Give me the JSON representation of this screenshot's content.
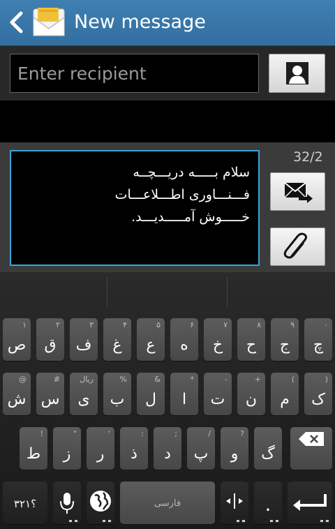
{
  "header": {
    "title": "New message",
    "back_icon": "chevron-left-icon",
    "app_icon": "envelope-icon"
  },
  "recipient": {
    "placeholder": "Enter recipient",
    "contact_icon": "contact-person-icon"
  },
  "compose": {
    "message": "سلام بـــــه دریـــچــه\nفـــنـــاوری اطـــلاعـــات\nخـــــوش آمـــــدیـــد.",
    "counter": "32/2",
    "send_icon": "send-message-icon",
    "attach_icon": "paperclip-icon"
  },
  "keyboard": {
    "row1": [
      {
        "main": "ص",
        "sub": "۱"
      },
      {
        "main": "ق",
        "sub": "۲"
      },
      {
        "main": "ف",
        "sub": "۳"
      },
      {
        "main": "غ",
        "sub": "۴"
      },
      {
        "main": "ع",
        "sub": "۵"
      },
      {
        "main": "ه",
        "sub": "۶"
      },
      {
        "main": "خ",
        "sub": "۷"
      },
      {
        "main": "ح",
        "sub": "۸"
      },
      {
        "main": "ج",
        "sub": "۹"
      },
      {
        "main": "چ",
        "sub": "۰"
      }
    ],
    "row2": [
      {
        "main": "ش",
        "sub": "@"
      },
      {
        "main": "س",
        "sub": "#"
      },
      {
        "main": "ی",
        "sub": "ریال"
      },
      {
        "main": "ب",
        "sub": "%"
      },
      {
        "main": "ل",
        "sub": "&"
      },
      {
        "main": "ا",
        "sub": "*"
      },
      {
        "main": "ت",
        "sub": "-"
      },
      {
        "main": "ن",
        "sub": "+"
      },
      {
        "main": "م",
        "sub": "("
      },
      {
        "main": "ک",
        "sub": ")"
      }
    ],
    "row3": [
      {
        "main": "ط",
        "sub": "!"
      },
      {
        "main": "ز",
        "sub": "\""
      },
      {
        "main": "ر",
        "sub": "'"
      },
      {
        "main": "ذ",
        "sub": ":"
      },
      {
        "main": "د",
        "sub": ";"
      },
      {
        "main": "پ",
        "sub": "/"
      },
      {
        "main": "و",
        "sub": "?"
      },
      {
        "main": "گ",
        "sub": ""
      }
    ],
    "symbols_label": "؟۳۲۱",
    "space_label": "فارسی",
    "period_label": "."
  }
}
